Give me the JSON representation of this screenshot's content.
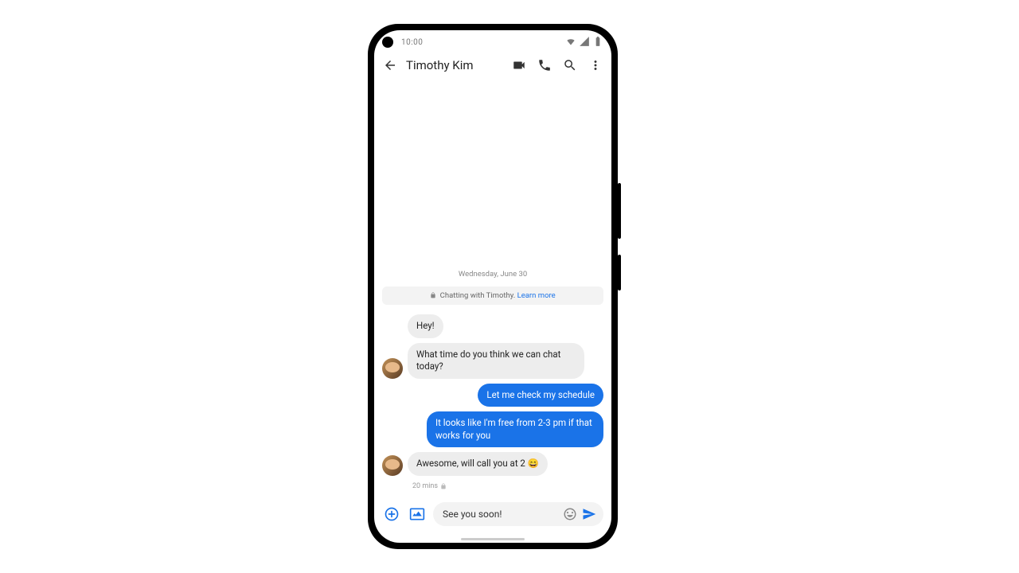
{
  "status": {
    "time": "10:00"
  },
  "header": {
    "contact_name": "Timothy Kim"
  },
  "conversation": {
    "date_label": "Wednesday, June 30",
    "banner_text": "Chatting with Timothy.",
    "banner_link": "Learn more",
    "messages": [
      {
        "from": "them",
        "text": "Hey!"
      },
      {
        "from": "them",
        "text": "What time do you think we can chat today?"
      },
      {
        "from": "me",
        "text": "Let me check my schedule"
      },
      {
        "from": "me",
        "text": "It looks like I'm free from 2-3 pm if that works for you"
      },
      {
        "from": "them",
        "text": "Awesome, will call you at 2  😄"
      }
    ],
    "last_meta": "20 mins"
  },
  "composer": {
    "draft": "See you soon!"
  },
  "icons": {
    "back": "back-arrow-icon",
    "video": "video-icon",
    "call": "phone-icon",
    "search": "search-icon",
    "more": "more-vert-icon",
    "wifi": "wifi-icon",
    "signal": "signal-icon",
    "battery": "battery-icon",
    "lock": "lock-icon",
    "plus": "plus-icon",
    "gallery": "gallery-icon",
    "emoji": "emoji-icon",
    "send": "send-icon"
  }
}
